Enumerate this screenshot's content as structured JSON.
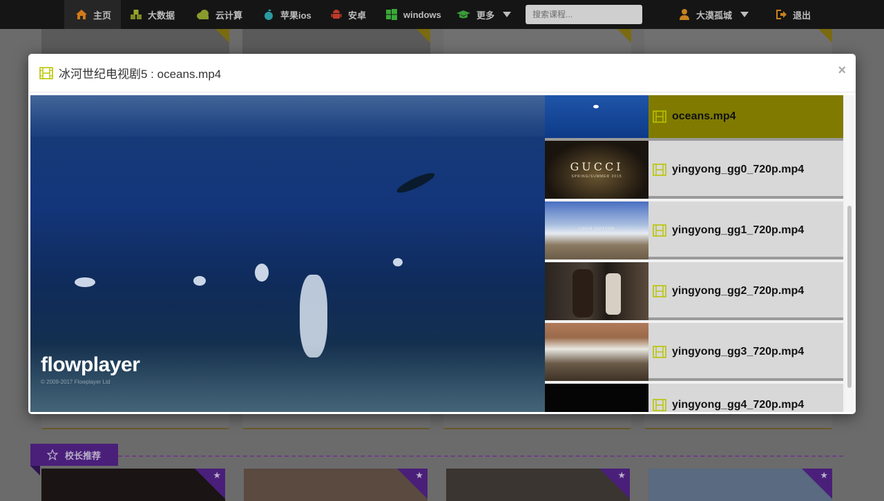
{
  "nav": {
    "items": [
      {
        "label": "主页",
        "icon": "home-icon",
        "color": "#d07a1a"
      },
      {
        "label": "大数据",
        "icon": "cubes-icon",
        "color": "#7f8a21"
      },
      {
        "label": "云计算",
        "icon": "cloud-icon",
        "color": "#8a9a2c"
      },
      {
        "label": "苹果ios",
        "icon": "apple-icon",
        "color": "#2a9aa0"
      },
      {
        "label": "安卓",
        "icon": "android-icon",
        "color": "#c03a2a"
      },
      {
        "label": "windows",
        "icon": "windows-icon",
        "color": "#39a839"
      },
      {
        "label": "更多",
        "icon": "graduation-cap-icon",
        "color": "#3a9a3a"
      }
    ],
    "search_placeholder": "搜索课程...",
    "user": {
      "label": "大漠孤城",
      "icon": "user-icon",
      "color": "#c8821e"
    },
    "logout": {
      "label": "退出",
      "icon": "sign-out-icon",
      "color": "#c8821e"
    }
  },
  "modal": {
    "title": "冰河世纪电视剧5 : oceans.mp4",
    "close": "×"
  },
  "player": {
    "logo": "flowplayer",
    "copyright": "© 2009-2017 Flowplayer Ltd"
  },
  "playlist": {
    "items": [
      {
        "label": "oceans.mp4",
        "active": true
      },
      {
        "label": "yingyong_gg0_720p.mp4",
        "active": false
      },
      {
        "label": "yingyong_gg1_720p.mp4",
        "active": false
      },
      {
        "label": "yingyong_gg2_720p.mp4",
        "active": false
      },
      {
        "label": "yingyong_gg3_720p.mp4",
        "active": false
      },
      {
        "label": "yingyong_gg4_720p.mp4",
        "active": false
      }
    ],
    "thumb_text": {
      "gucci": "GUCCI",
      "gucci_sub": "SPRING/SUMMER 2015",
      "lv": "LOUIS VUITTON"
    }
  },
  "section": {
    "title": "校长推荐",
    "icon": "star-outline-icon"
  },
  "colors": {
    "accent_olive": "#807b00",
    "film_icon": "#b8c400",
    "purple": "#4a1f7a"
  }
}
